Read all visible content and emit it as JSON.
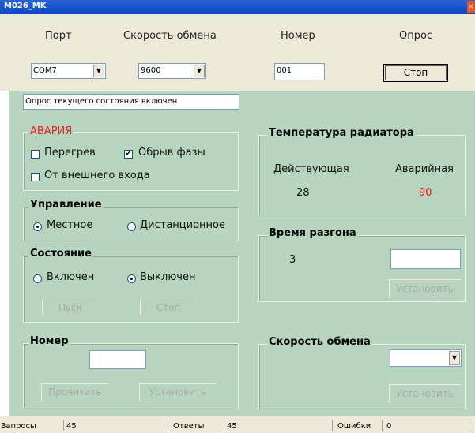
{
  "window": {
    "title": "M026_MK",
    "close_glyph": "×"
  },
  "toolbar": {
    "port_label": "Порт",
    "port_value": "COM7",
    "speed_label": "Скорость обмена",
    "speed_value": "9600",
    "number_label": "Номер",
    "number_value": "001",
    "poll_label": "Опрос",
    "poll_button": "Стоп"
  },
  "status_message": "Опрос текущего состояния включен",
  "alarm": {
    "title": "АВАРИЯ",
    "overheat": "Перегрев",
    "overheat_checked": false,
    "phase_break": "Обрыв фазы",
    "phase_break_checked": true,
    "external_input": "От внешнего входа",
    "external_input_checked": false,
    "color": "#e02020"
  },
  "control": {
    "title": "Управление",
    "local": "Местное",
    "remote": "Дистанционное",
    "selected": "local"
  },
  "state": {
    "title": "Состояние",
    "on": "Включен",
    "off": "Выключен",
    "selected": "off",
    "start_button": "Пуск",
    "stop_button": "Стоп"
  },
  "number_group": {
    "title": "Номер",
    "value": "",
    "read_button": "Прочитать",
    "set_button": "Установить"
  },
  "radiator": {
    "title": "Температура радиатора",
    "current_label": "Действующая",
    "alarm_label": "Аварийная",
    "current_value": "28",
    "alarm_value": "90",
    "alarm_color": "#e02020"
  },
  "accel": {
    "title": "Время разгона",
    "value": "3",
    "input_value": "",
    "set_button": "Установить"
  },
  "exchange_speed": {
    "title": "Скорость обмена",
    "value": "",
    "set_button": "Установить"
  },
  "statusbar": {
    "requests_label": "Запросы",
    "requests_value": "45",
    "responses_label": "Ответы",
    "responses_value": "45",
    "errors_label": "Ошибки",
    "errors_value": "0"
  },
  "icons": {
    "dropdown": "chevron-down-icon",
    "check": "check-icon"
  },
  "colors": {
    "client_bg": "#b7d5be",
    "titlebar": "#0b46c4",
    "topbar": "#ece9d8"
  }
}
